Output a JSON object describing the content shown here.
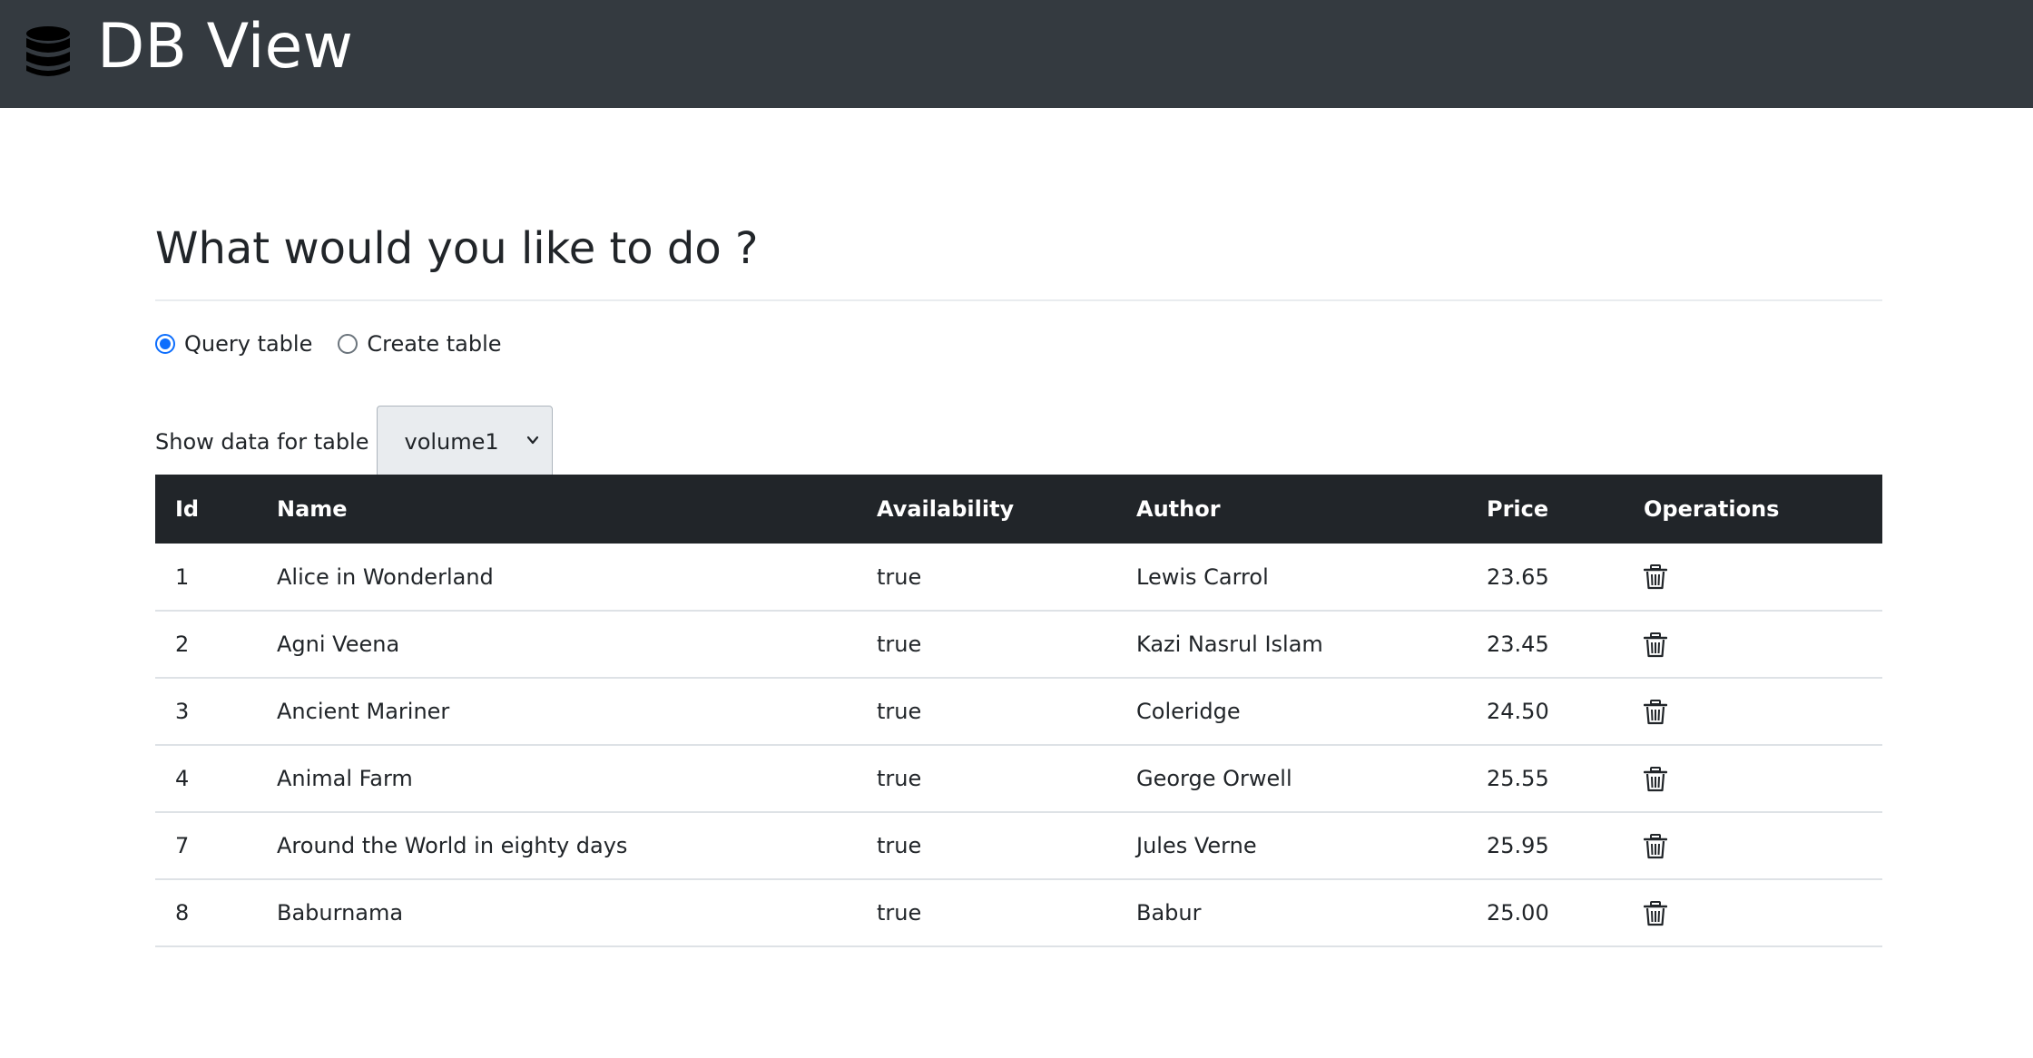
{
  "navbar": {
    "brand_title": "DB View",
    "brand_icon": "database-icon"
  },
  "main": {
    "heading": "What would you like to do ?",
    "mode_options": [
      {
        "label": "Query table",
        "checked": true
      },
      {
        "label": "Create table",
        "checked": false
      }
    ],
    "table_select": {
      "label": "Show data for table",
      "selected": "volume1"
    }
  },
  "table": {
    "columns": [
      "Id",
      "Name",
      "Availability",
      "Author",
      "Price",
      "Operations"
    ],
    "rows": [
      {
        "id": "1",
        "name": "Alice in Wonderland",
        "availability": "true",
        "author": "Lewis Carrol",
        "price": "23.65",
        "operation_icon": "trash-icon"
      },
      {
        "id": "2",
        "name": "Agni Veena",
        "availability": "true",
        "author": "Kazi Nasrul Islam",
        "price": "23.45",
        "operation_icon": "trash-icon"
      },
      {
        "id": "3",
        "name": "Ancient Mariner",
        "availability": "true",
        "author": "Coleridge",
        "price": "24.50",
        "operation_icon": "trash-icon"
      },
      {
        "id": "4",
        "name": "Animal Farm",
        "availability": "true",
        "author": "George Orwell",
        "price": "25.55",
        "operation_icon": "trash-icon"
      },
      {
        "id": "7",
        "name": "Around the World in eighty days",
        "availability": "true",
        "author": "Jules Verne",
        "price": "25.95",
        "operation_icon": "trash-icon"
      },
      {
        "id": "8",
        "name": "Baburnama",
        "availability": "true",
        "author": "Babur",
        "price": "25.00",
        "operation_icon": "trash-icon"
      }
    ]
  },
  "colors": {
    "navbar_bg": "#343a40",
    "table_header_bg": "#212529",
    "accent": "#0d6efd"
  }
}
